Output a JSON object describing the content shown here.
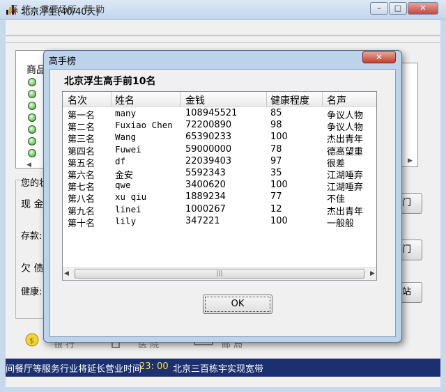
{
  "window": {
    "title": "北京浮生(40/40天)",
    "min_label": "–",
    "max_label": "□",
    "close_label": "✕"
  },
  "menu": [
    "系 统",
    "重要场所",
    "帮 助"
  ],
  "background": {
    "goods_header": "商品",
    "status_group_label": "您的状",
    "cash_label": "现 金",
    "deposit_label": "存款:",
    "debt_label": "欠 债",
    "health_label": "健康:",
    "right_buttons": [
      "门",
      "门",
      "站"
    ],
    "bank_label": "银 行",
    "hospital_label": "医 院",
    "post_label": "邮 局"
  },
  "ticker": {
    "text_a": "间餐厅等服务行业将延长营业时间",
    "time": "23: 00",
    "text_b": "北京三百栋宇实现宽带"
  },
  "dialog": {
    "title": "高手榜",
    "close_label": "✕",
    "heading": "北京浮生高手前10名",
    "ok_label": "OK",
    "columns": [
      "名次",
      "姓名",
      "金钱",
      "健康程度",
      "名声"
    ],
    "rows": [
      {
        "rank": "第一名",
        "name": "many",
        "money": "108945521",
        "health": "85",
        "fame": "争议人物"
      },
      {
        "rank": "第二名",
        "name": "Fuxiao Chen",
        "money": "72200890",
        "health": "98",
        "fame": "争议人物"
      },
      {
        "rank": "第三名",
        "name": "Wang",
        "money": "65390233",
        "health": "100",
        "fame": "杰出青年"
      },
      {
        "rank": "第四名",
        "name": "Fuwei",
        "money": "59000000",
        "health": "78",
        "fame": "德高望重"
      },
      {
        "rank": "第五名",
        "name": "df",
        "money": "22039403",
        "health": "97",
        "fame": "很差"
      },
      {
        "rank": "第六名",
        "name": "金安",
        "money": "5592343",
        "health": "35",
        "fame": "江湖唾弃"
      },
      {
        "rank": "第七名",
        "name": "qwe",
        "money": "3400620",
        "health": "100",
        "fame": "江湖唾弃"
      },
      {
        "rank": "第八名",
        "name": "xu qiu",
        "money": "1889234",
        "health": "77",
        "fame": "不佳"
      },
      {
        "rank": "第九名",
        "name": "linei",
        "money": "1000267",
        "health": "12",
        "fame": "杰出青年"
      },
      {
        "rank": "第十名",
        "name": "lily",
        "money": "347221",
        "health": "100",
        "fame": "一般般"
      }
    ]
  }
}
